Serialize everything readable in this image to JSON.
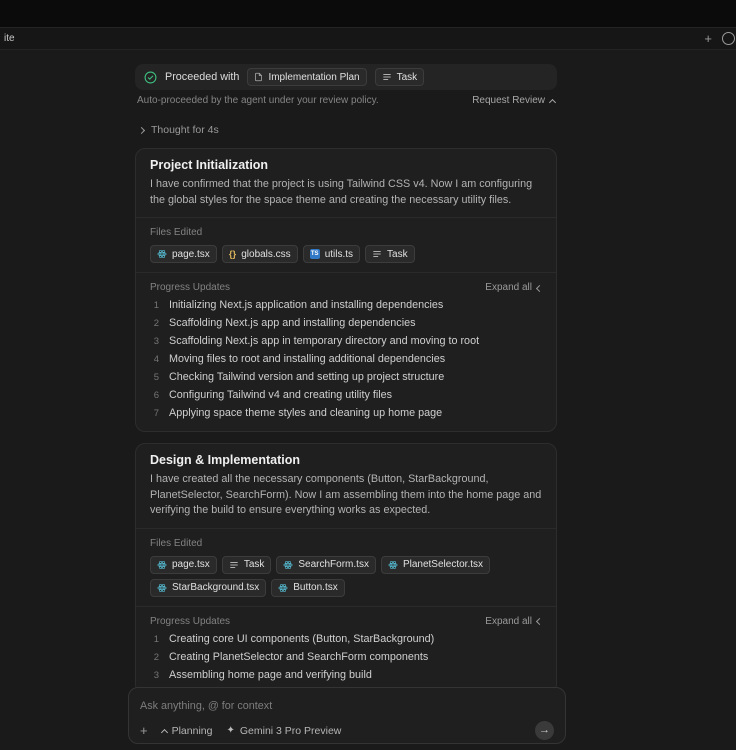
{
  "toolbar": {
    "partial_tab": "ite",
    "new_chat": "+"
  },
  "banner": {
    "label": "Proceeded with",
    "chips": [
      {
        "label": "Implementation Plan"
      },
      {
        "label": "Task"
      }
    ]
  },
  "review": {
    "note": "Auto-proceeded by the agent under your review policy.",
    "action": "Request Review"
  },
  "thought": {
    "label": "Thought for 4s"
  },
  "cards": [
    {
      "title": "Project Initialization",
      "body": "I have confirmed that the project is using Tailwind CSS v4. Now I am configuring the global styles for the space theme and creating the necessary utility files.",
      "files_label": "Files Edited",
      "files": [
        {
          "name": "page.tsx"
        },
        {
          "name": "globals.css"
        },
        {
          "name": "utils.ts"
        },
        {
          "name": "Task"
        }
      ],
      "progress_label": "Progress Updates",
      "expand_label": "Expand all",
      "updates": [
        {
          "n": "1",
          "text": "Initializing Next.js application and installing dependencies"
        },
        {
          "n": "2",
          "text": "Scaffolding Next.js app and installing dependencies"
        },
        {
          "n": "3",
          "text": "Scaffolding Next.js app in temporary directory and moving to root"
        },
        {
          "n": "4",
          "text": "Moving files to root and installing additional dependencies"
        },
        {
          "n": "5",
          "text": "Checking Tailwind version and setting up project structure"
        },
        {
          "n": "6",
          "text": "Configuring Tailwind v4 and creating utility files"
        },
        {
          "n": "7",
          "text": "Applying space theme styles and cleaning up home page"
        }
      ]
    },
    {
      "title": "Design & Implementation",
      "body": "I have created all the necessary components (Button, StarBackground, PlanetSelector, SearchForm). Now I am assembling them into the home page and verifying the build to ensure everything works as expected.",
      "files_label": "Files Edited",
      "files": [
        {
          "name": "page.tsx"
        },
        {
          "name": "Task"
        },
        {
          "name": "SearchForm.tsx"
        },
        {
          "name": "PlanetSelector.tsx"
        },
        {
          "name": "StarBackground.tsx"
        },
        {
          "name": "Button.tsx"
        }
      ],
      "progress_label": "Progress Updates",
      "expand_label": "Expand all",
      "updates": [
        {
          "n": "1",
          "text": "Creating core UI components (Button, StarBackground)"
        },
        {
          "n": "2",
          "text": "Creating PlanetSelector and SearchForm components"
        },
        {
          "n": "3",
          "text": "Assembling home page and verifying build"
        }
      ]
    }
  ],
  "composer": {
    "placeholder": "Ask anything, @ for context",
    "attach": "+",
    "mode": "Planning",
    "model": "Gemini 3 Pro Preview",
    "send": "→"
  },
  "icons": {
    "ts_label": "TS",
    "braces": "{}"
  },
  "colors": {
    "accent_green": "#3fbf7f",
    "react_blue": "#58c4dc",
    "ts_blue": "#3178c6",
    "braces_yellow": "#d8b05a",
    "card_bg": "#1f1f1f",
    "page_bg": "#1a1a1a"
  }
}
